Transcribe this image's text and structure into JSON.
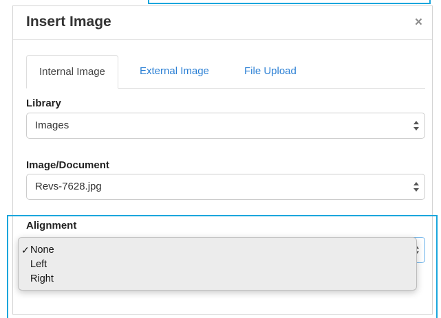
{
  "dialog": {
    "title": "Insert Image",
    "close_symbol": "×"
  },
  "tabs": [
    {
      "label": "Internal Image",
      "active": true
    },
    {
      "label": "External Image",
      "active": false
    },
    {
      "label": "File Upload",
      "active": false
    }
  ],
  "library": {
    "label": "Library",
    "value": "Images"
  },
  "document": {
    "label": "Image/Document",
    "value": "Revs-7628.jpg"
  },
  "alignment": {
    "label": "Alignment",
    "value": "None",
    "check_mark": "✓",
    "options": [
      "None",
      "Left",
      "Right"
    ]
  },
  "icons": {
    "close": "close-icon",
    "select_arrows": "chevron-up-down-icon",
    "check": "checkmark-icon"
  },
  "colors": {
    "accent": "#1aa6dc",
    "link": "#2a7fd4",
    "focus_border": "#66afe9"
  }
}
